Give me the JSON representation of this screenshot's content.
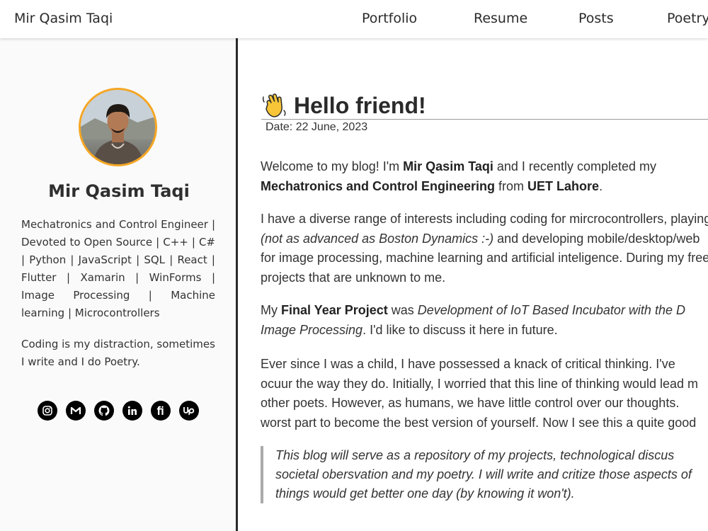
{
  "header": {
    "brand": "Mir Qasim Taqi",
    "nav": [
      "Portfolio",
      "Resume",
      "Posts",
      "Poetry"
    ]
  },
  "sidebar": {
    "avatar_icon": "profile-photo",
    "name": "Mir Qasim Taqi",
    "bio": "Mechatronics and Control Engineer | Devoted to Open Source | C++ | C# | Python | JavaScript | SQL | React | Flutter | Xamarin | WinForms | Image Processing | Machine learning | Microcontrollers",
    "tagline": "Coding is my distraction, sometimes I write and I do Poetry.",
    "socials": [
      "instagram-icon",
      "gmail-icon",
      "github-icon",
      "linkedin-icon",
      "fiverr-icon",
      "upwork-icon"
    ],
    "accent_color": "#f5a623"
  },
  "post": {
    "emoji": "waving-hand",
    "title": "Hello friend!",
    "date": "Date: 22 June, 2023",
    "p1": {
      "l1a": "Welcome to my blog! I'm ",
      "l1b": "Mir Qasim Taqi",
      "l1c": " and I recently completed my",
      "l2a": "Mechatronics and Control Engineering",
      "l2b": " from ",
      "l2c": "UET Lahore",
      "l2d": "."
    },
    "p2": {
      "l1": "I have a diverse range of interests including coding for mircrocontrollers, playing",
      "l2a": "(not as advanced as Boston Dynamics :-)",
      "l2b": " and developing mobile/desktop/web",
      "l3": "for image processing, machine learning and artificial inteligence. During my free",
      "l4": "projects that are unknown to me."
    },
    "p3": {
      "l1a": "My ",
      "l1b": "Final Year Project",
      "l1c": " was ",
      "l1d": "Development of IoT Based Incubator with the D",
      "l2a": "Image Processing",
      "l2b": ". I'd like to discuss it here in future."
    },
    "p4": {
      "l1": "Ever since I was a child, I have possessed a knack of critical thinking. I've",
      "l2": "ocuur the way they do. Initially, I worried that this line of thinking would lead m",
      "l3": "other poets. However, as humans, we have little control over our thoughts.",
      "l4": "worst part to become the best version of yourself. Now I see this a quite good"
    },
    "quote": {
      "l1": "This blog will serve as a repository of my projects, technological discus",
      "l2": "societal obersvation and my poetry. I will write and critize those aspects of",
      "l3": "things would get better one day (by knowing it won't)."
    }
  }
}
